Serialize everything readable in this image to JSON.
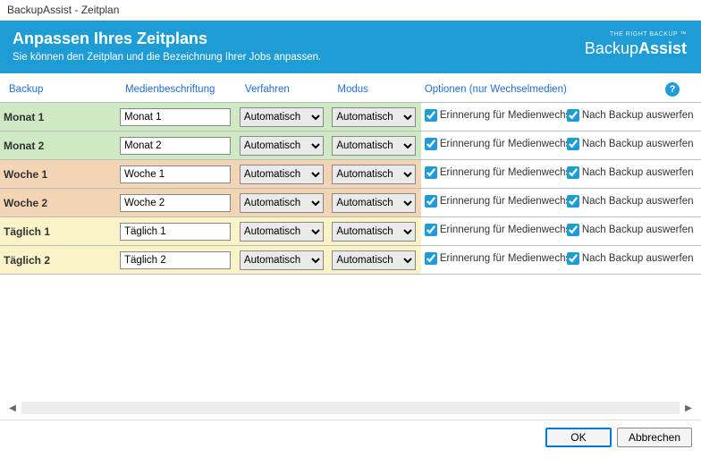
{
  "window_title": "BackupAssist - Zeitplan",
  "header": {
    "title": "Anpassen Ihres Zeitplans",
    "subtitle": "Sie können den Zeitplan und die Bezeichnung Ihrer Jobs anpassen.",
    "brand_tagline": "THE RIGHT BACKUP ™",
    "brand_name_a": "Backup",
    "brand_name_b": "Assist"
  },
  "columns": {
    "backup": "Backup",
    "medien": "Medienbeschriftung",
    "verfahren": "Verfahren",
    "modus": "Modus",
    "optionen": "Optionen (nur Wechselmedien)"
  },
  "select_options": {
    "automatisch": "Automatisch"
  },
  "checkbox_labels": {
    "erinnerung": "Erinnerung für Medienwechsel",
    "auswerfen": "Nach Backup auswerfen"
  },
  "rows": [
    {
      "name": "Monat 1",
      "label": "Monat 1",
      "verfahren": "Automatisch",
      "modus": "Automatisch",
      "erinnerung": true,
      "auswerfen": true,
      "style": "row-green"
    },
    {
      "name": "Monat 2",
      "label": "Monat 2",
      "verfahren": "Automatisch",
      "modus": "Automatisch",
      "erinnerung": true,
      "auswerfen": true,
      "style": "row-green"
    },
    {
      "name": "Woche 1",
      "label": "Woche 1",
      "verfahren": "Automatisch",
      "modus": "Automatisch",
      "erinnerung": true,
      "auswerfen": true,
      "style": "row-orange"
    },
    {
      "name": "Woche 2",
      "label": "Woche 2",
      "verfahren": "Automatisch",
      "modus": "Automatisch",
      "erinnerung": true,
      "auswerfen": true,
      "style": "row-orange"
    },
    {
      "name": "Täglich 1",
      "label": "Täglich 1",
      "verfahren": "Automatisch",
      "modus": "Automatisch",
      "erinnerung": true,
      "auswerfen": true,
      "style": "row-yellow"
    },
    {
      "name": "Täglich 2",
      "label": "Täglich 2",
      "verfahren": "Automatisch",
      "modus": "Automatisch",
      "erinnerung": true,
      "auswerfen": true,
      "style": "row-yellow"
    }
  ],
  "footer": {
    "ok": "OK",
    "cancel": "Abbrechen"
  },
  "help_glyph": "?"
}
